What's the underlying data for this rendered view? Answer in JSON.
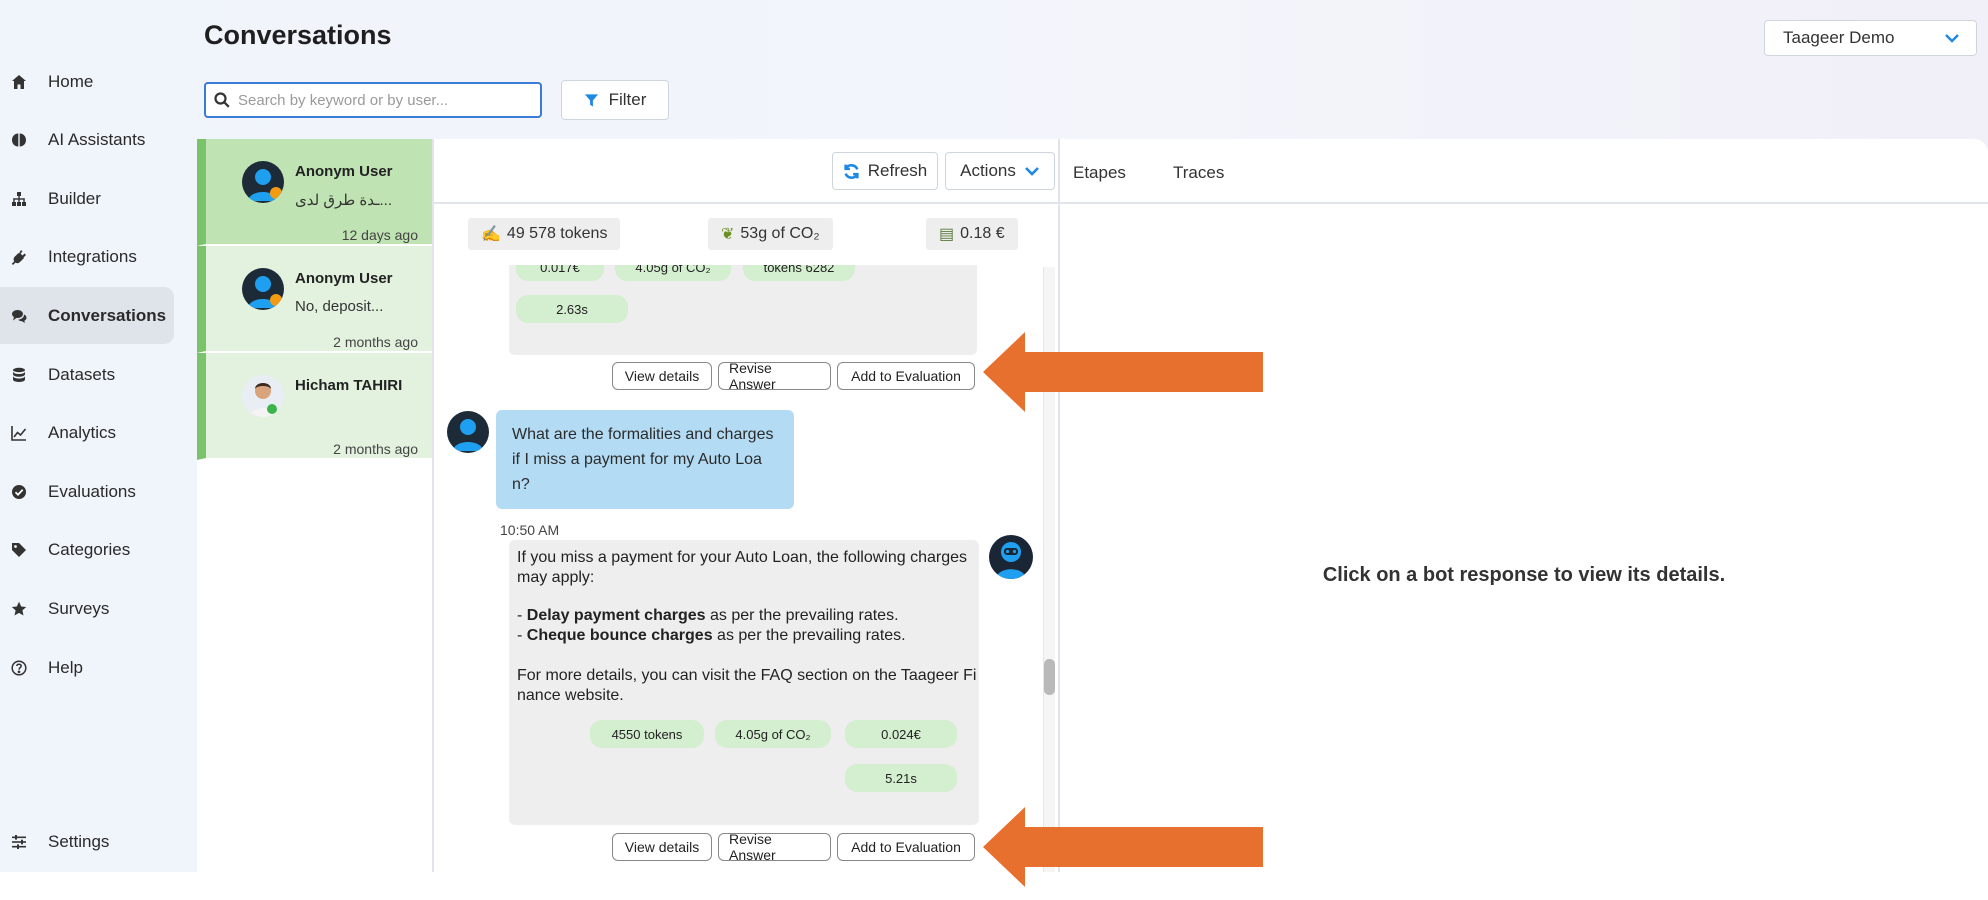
{
  "page": {
    "title": "Conversations"
  },
  "sidebar": {
    "items": [
      {
        "label": "Home",
        "icon": "home-icon"
      },
      {
        "label": "AI Assistants",
        "icon": "brain-icon"
      },
      {
        "label": "Builder",
        "icon": "sitemap-icon"
      },
      {
        "label": "Integrations",
        "icon": "plug-icon"
      },
      {
        "label": "Conversations",
        "icon": "chat-icon",
        "active": true
      },
      {
        "label": "Datasets",
        "icon": "database-icon"
      },
      {
        "label": "Analytics",
        "icon": "line-chart-icon"
      },
      {
        "label": "Evaluations",
        "icon": "check-circle-icon"
      },
      {
        "label": "Categories",
        "icon": "tag-icon"
      },
      {
        "label": "Surveys",
        "icon": "star-icon"
      },
      {
        "label": "Help",
        "icon": "help-circle-icon"
      }
    ],
    "settings_label": "Settings"
  },
  "search": {
    "placeholder": "Search by keyword or by user..."
  },
  "filter": {
    "label": "Filter"
  },
  "workspace": {
    "selected": "Taageer Demo"
  },
  "conversations": [
    {
      "name": "Anonym User",
      "preview": "...ـدة طرق لدى",
      "time": "12 days ago",
      "selected": true
    },
    {
      "name": "Anonym User",
      "preview": "No, deposit...",
      "time": "2 months ago"
    },
    {
      "name": "Hicham TAHIRI",
      "preview": "",
      "time": "2 months ago"
    }
  ],
  "toolbar": {
    "refresh_label": "Refresh",
    "actions_label": "Actions"
  },
  "stats": {
    "tokens": "49 578 tokens",
    "co2": "53g of CO₂",
    "cost": "0.18 €"
  },
  "messages": {
    "prev_bot": {
      "metrics_top": [
        "0.017€",
        "4.05g of CO₂",
        "tokens 6282"
      ],
      "duration": "2.63s",
      "buttons": {
        "view": "View details",
        "revise": "Revise Answer",
        "evaluate": "Add to Evaluation"
      }
    },
    "user": {
      "text": "What are the formalities and charges if I miss a payment for my Auto Loan?"
    },
    "bot": {
      "time": "10:50 AM",
      "intro": "If you miss a payment for your Auto Loan, the following charges may apply:",
      "bullet1_bold": "Delay payment charges",
      "bullet1_rest": " as per the prevailing rates.",
      "bullet2_bold": "Cheque bounce charges",
      "bullet2_rest": " as per the prevailing rates.",
      "outro": "For more details, you can visit the FAQ section on the Taageer Finance website.",
      "metrics": {
        "tokens": "4550 tokens",
        "co2": "4.05g of CO₂",
        "cost": "0.024€",
        "duration": "5.21s"
      },
      "buttons": {
        "view": "View details",
        "revise": "Revise Answer",
        "evaluate": "Add to Evaluation"
      }
    }
  },
  "details": {
    "tabs": [
      "Etapes",
      "Traces"
    ],
    "empty_text": "Click on a bot response to view its details."
  },
  "colors": {
    "accent": "#1e88e5",
    "conversation_green": "#7ac36a",
    "annotation_arrow": "#e8702e",
    "user_bubble": "#b3dcf4"
  }
}
